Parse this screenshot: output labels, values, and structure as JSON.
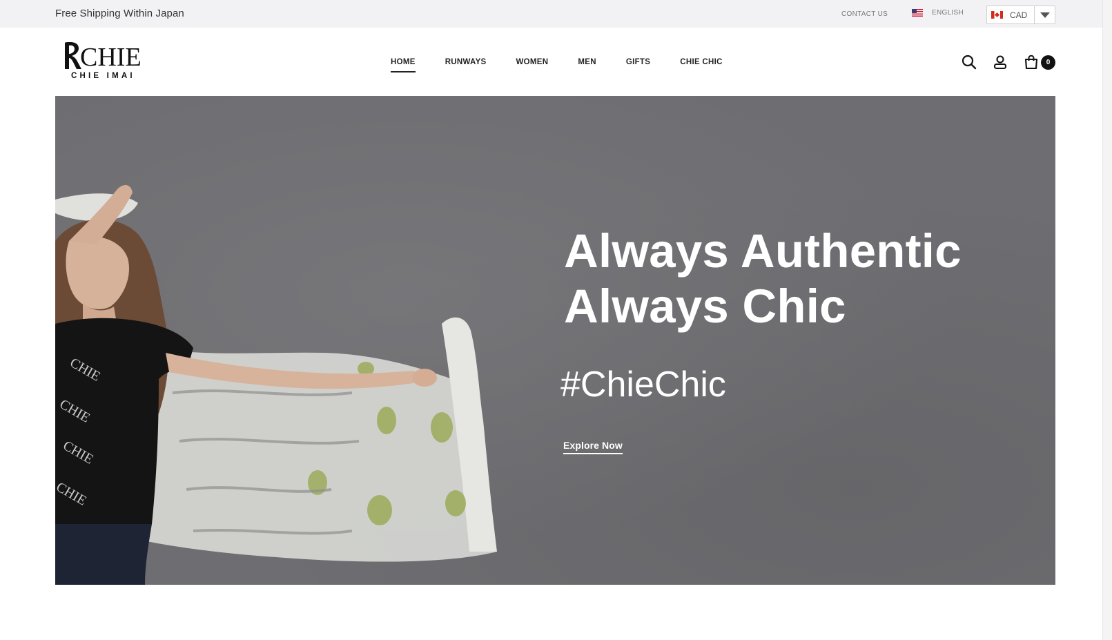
{
  "topbar": {
    "shipping_text": "Free Shipping Within Japan",
    "contact_label": "CONTACT US",
    "language_label": "ENGLISH",
    "currency_label": "CAD"
  },
  "header": {
    "logo": {
      "wordmark": "CHIE",
      "subtitle": "CHIE IMAI"
    },
    "nav": [
      {
        "label": "HOME",
        "active": true
      },
      {
        "label": "RUNWAYS"
      },
      {
        "label": "WOMEN"
      },
      {
        "label": "MEN"
      },
      {
        "label": "GIFTS"
      },
      {
        "label": "CHIE CHIC"
      }
    ],
    "cart_count": "0"
  },
  "hero": {
    "headline_line1": "Always Authentic",
    "headline_line2": "Always Chic",
    "hashtag": "#ChieChic",
    "cta_label": "Explore Now"
  },
  "colors": {
    "topbar_bg": "#f2f2f4",
    "hero_bg": "#6e6e72",
    "text_dark": "#222222",
    "badge_bg": "#111111"
  },
  "icons": [
    "search-icon",
    "user-icon",
    "cart-icon",
    "us-flag-icon",
    "canada-flag-icon",
    "chevron-down-icon"
  ]
}
